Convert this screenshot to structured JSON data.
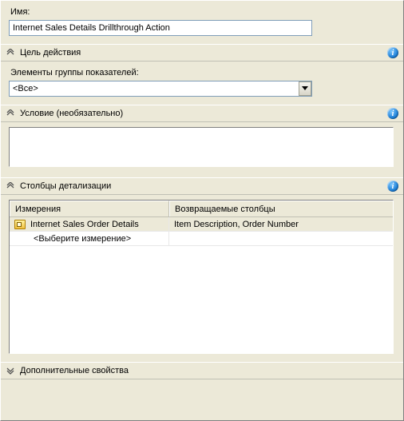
{
  "name": {
    "label": "Имя:",
    "value": "Internet Sales Details Drillthrough Action"
  },
  "sections": {
    "target": {
      "title": "Цель действия",
      "measure_group_label": "Элементы группы показателей:",
      "measure_group_value": "<Все>"
    },
    "condition": {
      "title": "Условие (необязательно)",
      "value": ""
    },
    "drillthrough": {
      "title": "Столбцы детализации",
      "columns": {
        "dimensions": "Измерения",
        "return_columns": "Возвращаемые столбцы"
      },
      "rows": [
        {
          "dimension": "Internet Sales Order Details",
          "columns": "Item Description, Order Number"
        }
      ],
      "placeholder": "<Выберите измерение>"
    },
    "additional": {
      "title": "Дополнительные свойства"
    }
  },
  "icons": {
    "info": "i"
  }
}
